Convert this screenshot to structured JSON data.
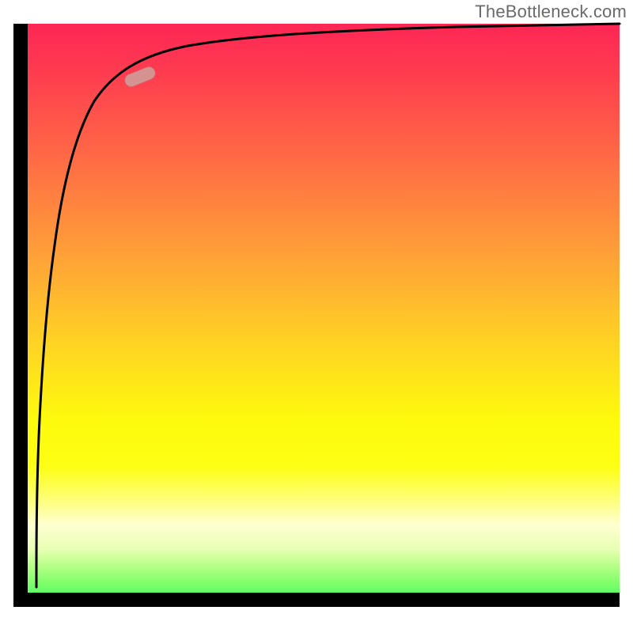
{
  "attribution": "TheBottleneck.com",
  "chart_data": {
    "type": "line",
    "title": "",
    "xlabel": "",
    "ylabel": "",
    "xlim": [
      0,
      100
    ],
    "ylim": [
      0,
      100
    ],
    "grid": false,
    "legend": false,
    "gradient_stops": [
      {
        "pct": 0,
        "color": "#fd2655"
      },
      {
        "pct": 8,
        "color": "#fe3b50"
      },
      {
        "pct": 22,
        "color": "#ff6746"
      },
      {
        "pct": 40,
        "color": "#ffa238"
      },
      {
        "pct": 55,
        "color": "#ffd424"
      },
      {
        "pct": 68,
        "color": "#fdfa0d"
      },
      {
        "pct": 76,
        "color": "#fdff14"
      },
      {
        "pct": 83,
        "color": "#feff94"
      },
      {
        "pct": 86,
        "color": "#feffd2"
      },
      {
        "pct": 90,
        "color": "#e9ffb4"
      },
      {
        "pct": 93,
        "color": "#b6ff87"
      },
      {
        "pct": 96,
        "color": "#7eff6a"
      },
      {
        "pct": 100,
        "color": "#2fff6a"
      }
    ],
    "series": [
      {
        "name": "curve",
        "x": [
          1.0,
          1.2,
          1.6,
          2.2,
          3.0,
          4.0,
          5.5,
          7.5,
          10,
          14,
          20,
          28,
          38,
          50,
          65,
          80,
          100
        ],
        "y": [
          3,
          30,
          55,
          70,
          78,
          83,
          86.5,
          89,
          91,
          92.5,
          94,
          95.2,
          96.2,
          97,
          97.6,
          98,
          98.5
        ]
      }
    ],
    "marker": {
      "shape": "rounded-pill",
      "x": 18,
      "y": 93.8,
      "angle_deg": -22,
      "color": "#d49290"
    }
  }
}
